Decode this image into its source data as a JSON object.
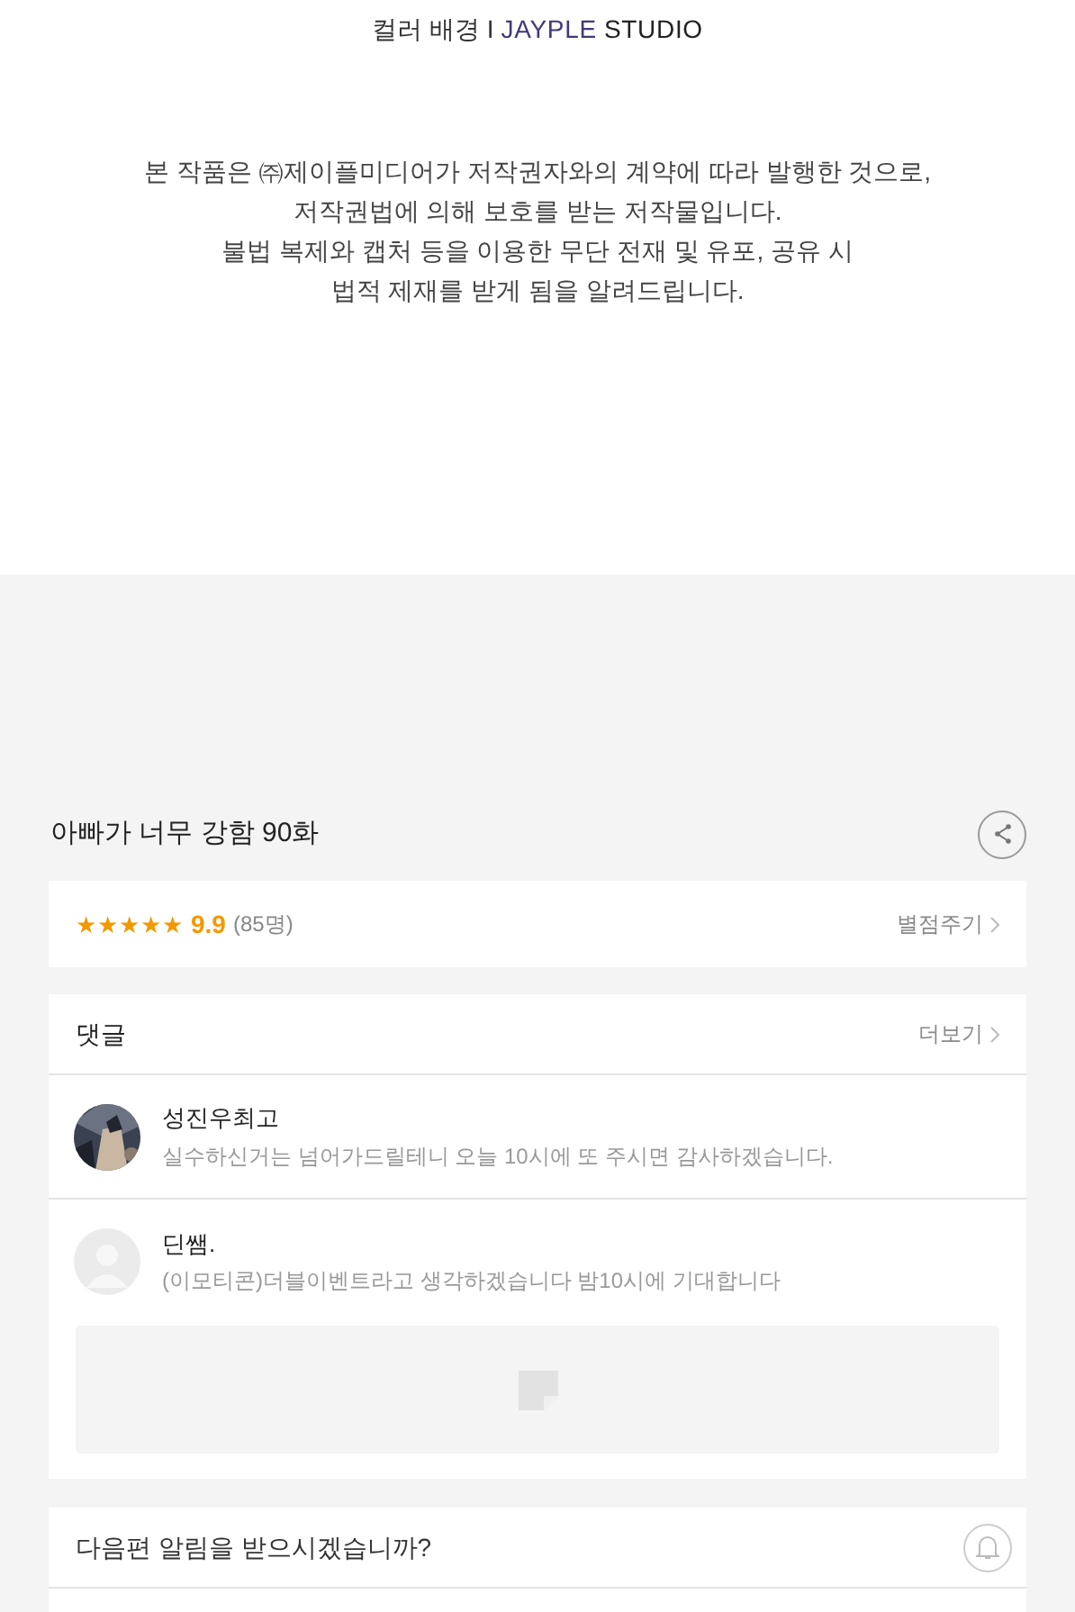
{
  "header": {
    "title_prefix": "컬러 배경 I",
    "brand_first": "JAYPLE",
    "brand_second": "STUDIO"
  },
  "notice": [
    "본 작품은 ㈜제이플미디어가 저작권자와의 계약에 따라 발행한 것으로,",
    "저작권법에 의해 보호를 받는 저작물입니다.",
    "불법 복제와 캡처 등을 이용한 무단 전재 및 유포, 공유 시",
    "법적 제재를 받게 됨을 알려드립니다."
  ],
  "episode": {
    "title": "아빠가 너무 강함 90화"
  },
  "rating": {
    "stars": 5,
    "score": "9.9",
    "count": "(85명)",
    "action": "별점주기"
  },
  "comments": {
    "title": "댓글",
    "more": "더보기",
    "items": [
      {
        "author": "성진우최고",
        "text": "실수하신거는 넘어가드릴테니 오늘 10시에 또 주시면 감사하겠습니다."
      },
      {
        "author": "딘쌤.",
        "text": "(이모티콘)더블이벤트라고 생각하겠습니다 밤10시에 기대합니다",
        "kind": "default"
      }
    ]
  },
  "alert": {
    "question": "다음편 알림을 받으시겠습니까?"
  }
}
